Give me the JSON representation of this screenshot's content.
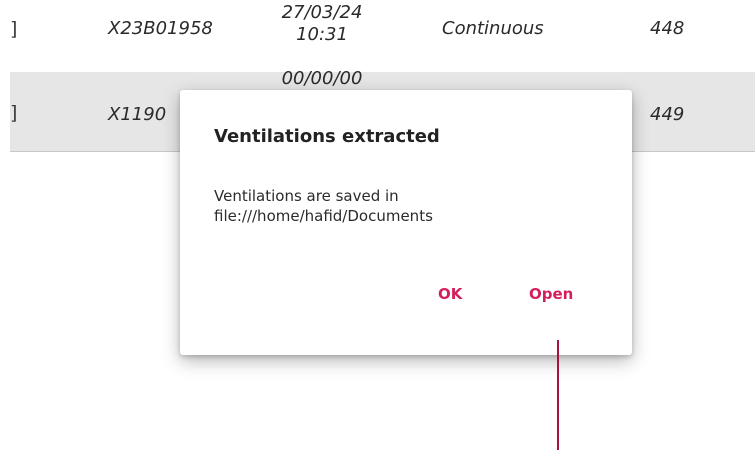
{
  "table": {
    "rows": [
      {
        "checkbox": "]",
        "serial": "X23B01958",
        "datetime_line1": "27/03/24",
        "datetime_line2": "10:31",
        "mode": "Continuous",
        "number": "448"
      },
      {
        "checkbox": "]",
        "serial": "X1190",
        "datetime_line1": "00/00/00",
        "number": "449"
      }
    ]
  },
  "dialog": {
    "title": "Ventilations extracted",
    "message": "Ventilations are saved in file:///home/hafid/Documents",
    "ok_label": "OK",
    "open_label": "Open"
  },
  "colors": {
    "accent": "#d21f5e",
    "selected_row": "#e6e6e6",
    "pointer_line": "#a5143c"
  }
}
